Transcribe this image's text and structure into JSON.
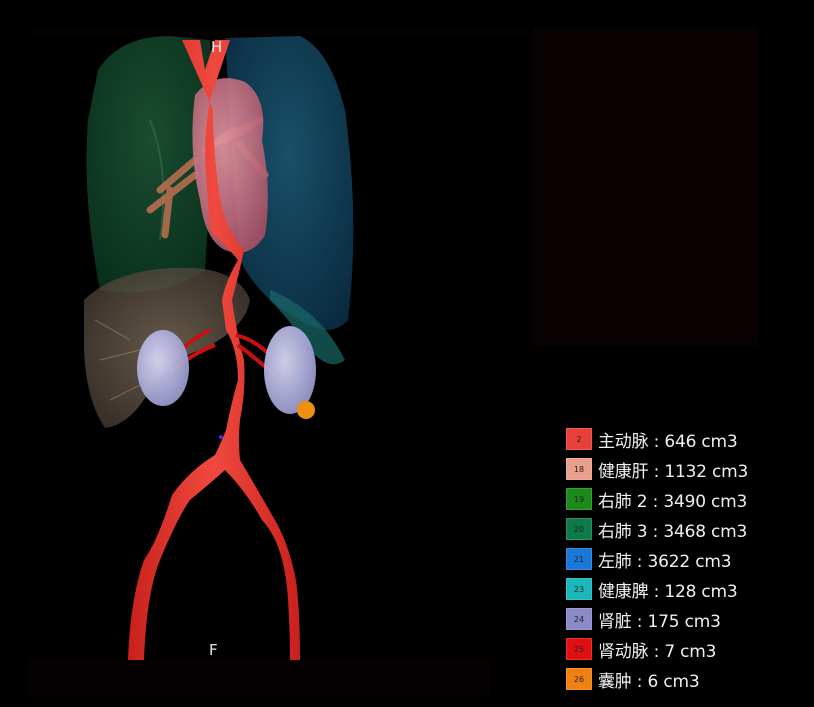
{
  "viewer": {
    "orientation": {
      "head": "H",
      "foot": "F"
    }
  },
  "legend": [
    {
      "id": "2",
      "label": "主动脉 : 646 cm3",
      "color": "#e8403a"
    },
    {
      "id": "18",
      "label": "健康肝 : 1132 cm3",
      "color": "#e8a08a"
    },
    {
      "id": "19",
      "label": "右肺 2 : 3490 cm3",
      "color": "#1a8a1a"
    },
    {
      "id": "20",
      "label": "右肺 3 : 3468 cm3",
      "color": "#0e7a4a"
    },
    {
      "id": "21",
      "label": "左肺 : 3622 cm3",
      "color": "#1a78d8"
    },
    {
      "id": "23",
      "label": "健康脾 : 128 cm3",
      "color": "#1ab8b8"
    },
    {
      "id": "24",
      "label": "肾脏 : 175 cm3",
      "color": "#8a8ac8"
    },
    {
      "id": "25",
      "label": "肾动脉 : 7 cm3",
      "color": "#e01010"
    },
    {
      "id": "26",
      "label": "囊肿 : 6 cm3",
      "color": "#f08010"
    }
  ]
}
